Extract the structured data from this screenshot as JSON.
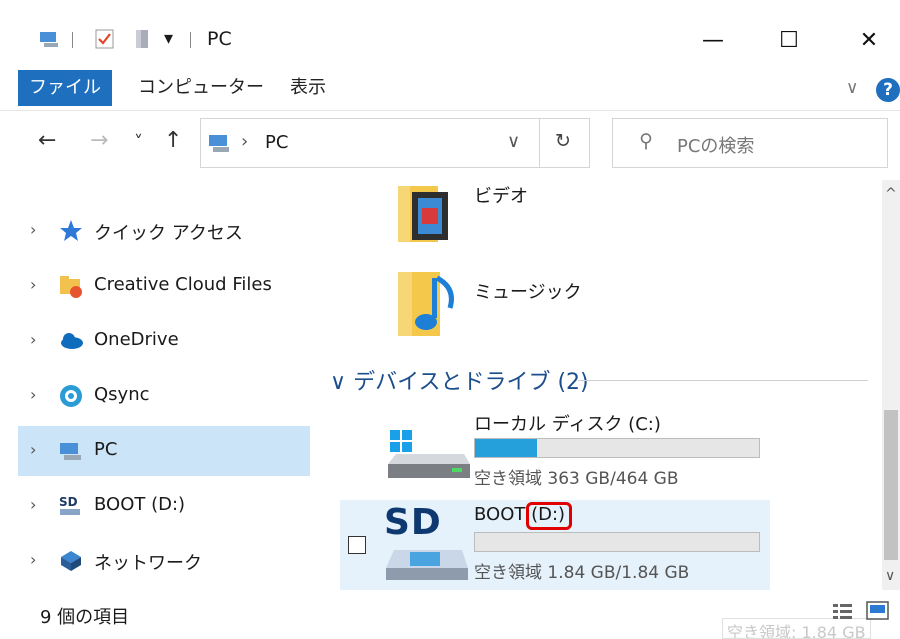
{
  "window": {
    "title": "PC",
    "minimize_glyph": "—",
    "maximize_glyph": "☐",
    "close_glyph": "✕"
  },
  "ribbon": {
    "tabs": [
      "ファイル",
      "コンピューター",
      "表示"
    ],
    "expand_glyph": "∨",
    "help_glyph": "?"
  },
  "nav": {
    "back_glyph": "←",
    "forward_glyph": "→",
    "recent_glyph": "˅",
    "up_glyph": "↑",
    "address_separator": "›",
    "address_path": "PC",
    "address_dropdown_glyph": "∨",
    "refresh_glyph": "↻",
    "search_glyph": "⚲",
    "search_placeholder": "PCの検索"
  },
  "sidebar": {
    "items": [
      {
        "label": "クイック アクセス",
        "icon": "star-icon"
      },
      {
        "label": "Creative Cloud Files",
        "icon": "creative-cloud-icon"
      },
      {
        "label": "OneDrive",
        "icon": "cloud-icon"
      },
      {
        "label": "Qsync",
        "icon": "qsync-icon"
      },
      {
        "label": "PC",
        "icon": "computer-icon",
        "selected": true
      },
      {
        "label": "BOOT (D:)",
        "icon": "sd-card-icon"
      },
      {
        "label": "ネットワーク",
        "icon": "network-icon"
      }
    ]
  },
  "content": {
    "folders": [
      {
        "label": "ビデオ",
        "icon": "video-folder-icon"
      },
      {
        "label": "ミュージック",
        "icon": "music-folder-icon"
      }
    ],
    "devices_group": {
      "title": "デバイスとドライブ (2)",
      "collapse_glyph": "∨"
    },
    "drives": [
      {
        "name": "ローカル ディスク (C:)",
        "space": "空き領域 363 GB/464 GB",
        "used_fraction": 0.22,
        "icon": "windows-drive-icon"
      },
      {
        "name": "BOOT (D:)",
        "space": "空き領域 1.84 GB/1.84 GB",
        "used_fraction": 0.0,
        "icon": "sd-card-drive-icon",
        "selected": true
      }
    ],
    "sd_text": "SD",
    "highlight_color": "#e00000"
  },
  "scroll": {
    "up_glyph": "^",
    "down_glyph": "∨"
  },
  "status": {
    "item_count": "9 個の項目",
    "ghost_text": "空き領域: 1.84 GB"
  },
  "colors": {
    "accent": "#1f6fbf",
    "selection": "#cce4f7",
    "bar_fill": "#26a0da"
  }
}
